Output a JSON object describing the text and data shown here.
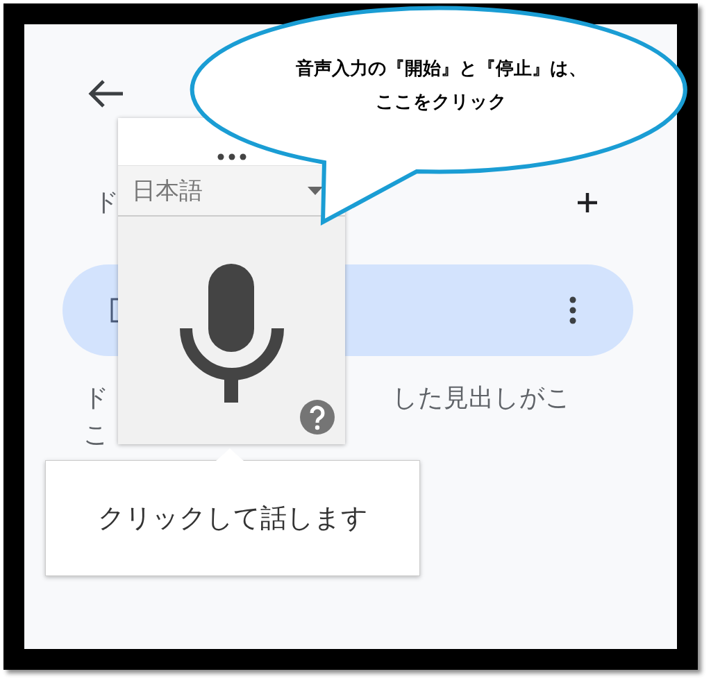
{
  "callout": {
    "lines": [
      "音声入力の『開始』と『停止』は、",
      "ここをクリック"
    ]
  },
  "panel": {
    "heading_fragment": "ド",
    "description_fragments": [
      "ド",
      "した見出しがこ",
      "こ"
    ]
  },
  "voice_typing": {
    "language": "日本語",
    "tooltip": "クリックして話します"
  }
}
